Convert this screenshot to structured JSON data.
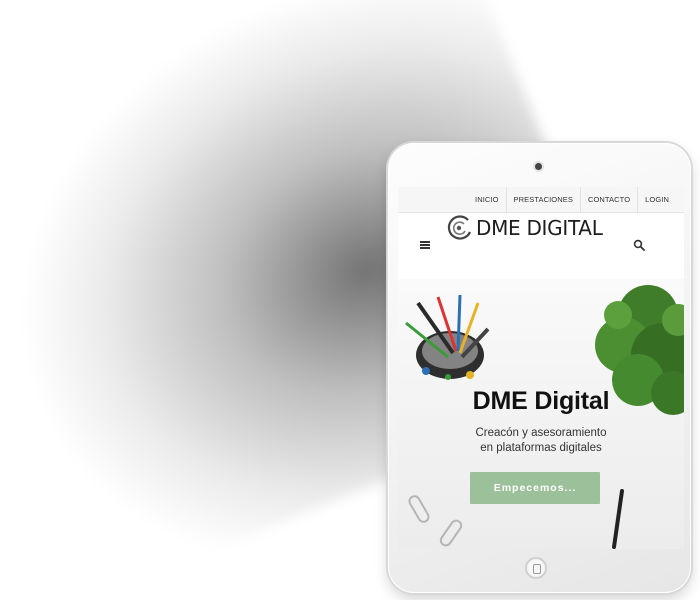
{
  "site": {
    "nav": [
      "INICIO",
      "PRESTACIONES",
      "CONTACTO",
      "LOGIN"
    ],
    "logo_text": "DME DIGITAL",
    "hero": {
      "title": "DME Digital",
      "subtitle_line1": "Creacón y asesoramiento",
      "subtitle_line2": "en plataformas digitales",
      "cta_label": "Empecemos..."
    }
  },
  "icons": {
    "menu": "hamburger-menu-icon",
    "search": "search-icon",
    "logo_mark": "dme-logo-icon"
  },
  "colors": {
    "cta_background": "#9cc19a",
    "cta_text": "#ffffff",
    "plant_green": "#3f7d2a"
  }
}
